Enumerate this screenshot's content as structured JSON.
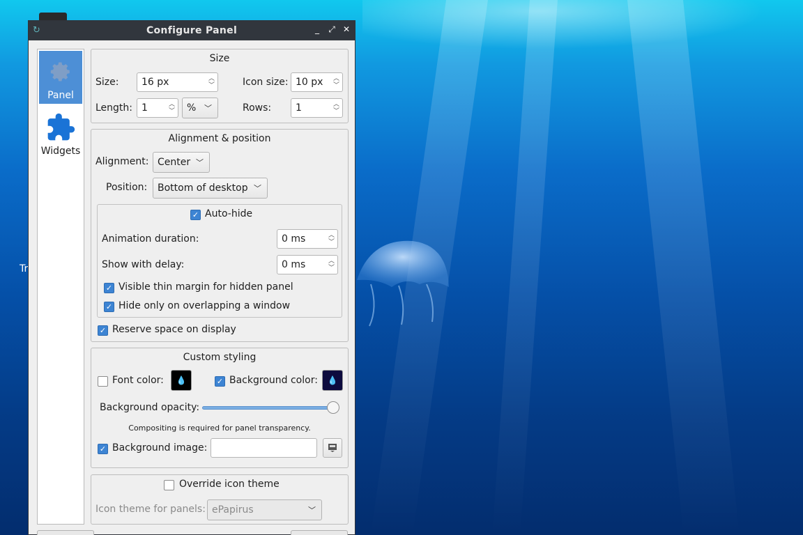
{
  "desktop": {
    "label_partial": "Tr"
  },
  "window": {
    "title": "Configure Panel",
    "controls": {
      "minimize": "_",
      "restore": "⤢",
      "close": "✕"
    }
  },
  "sidebar": {
    "items": [
      {
        "label": "Panel",
        "icon": "gear-icon",
        "active": true
      },
      {
        "label": "Widgets",
        "icon": "puzzle-icon",
        "active": false
      }
    ]
  },
  "size": {
    "title": "Size",
    "size_label": "Size:",
    "size_value": "16 px",
    "icon_size_label": "Icon size:",
    "icon_size_value": "10 px",
    "length_label": "Length:",
    "length_value": "1",
    "length_unit": "%",
    "rows_label": "Rows:",
    "rows_value": "1"
  },
  "alignment": {
    "title": "Alignment & position",
    "alignment_label": "Alignment:",
    "alignment_value": "Center",
    "position_label": "Position:",
    "position_value": "Bottom of desktop",
    "autohide_label": "Auto-hide",
    "autohide_checked": true,
    "anim_label": "Animation duration:",
    "anim_value": "0 ms",
    "delay_label": "Show with delay:",
    "delay_value": "0 ms",
    "thin_margin_label": "Visible thin margin for hidden panel",
    "thin_margin_checked": true,
    "overlap_label": "Hide only on overlapping a window",
    "overlap_checked": true,
    "reserve_label": "Reserve space on display",
    "reserve_checked": true
  },
  "styling": {
    "title": "Custom styling",
    "font_color_label": "Font color:",
    "font_color_checked": false,
    "font_color": "#000000",
    "bg_color_label": "Background color:",
    "bg_color_checked": true,
    "bg_color": "#0d0b3e",
    "opacity_label": "Background opacity:",
    "opacity_value": 1.0,
    "compositing_note": "Compositing is required for panel transparency.",
    "bg_image_label": "Background image:",
    "bg_image_checked": true,
    "bg_image_value": ""
  },
  "icon_theme": {
    "override_label": "Override icon theme",
    "override_checked": false,
    "theme_label": "Icon theme for panels:",
    "theme_value": "ePapirus"
  },
  "colors": {
    "accent": "#4d8fd6",
    "titlebar": "#31363d"
  }
}
